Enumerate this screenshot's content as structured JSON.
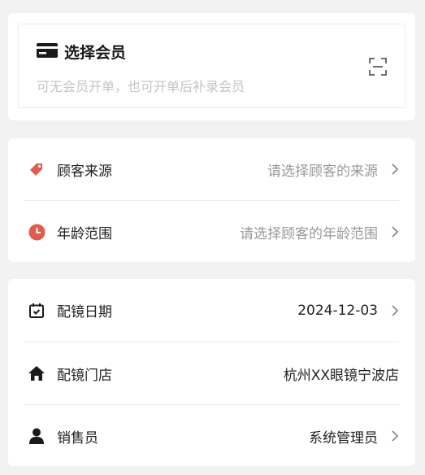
{
  "member": {
    "title": "选择会员",
    "hint": "可无会员开单，也可开单后补录会员",
    "icon": "card-icon",
    "scan_icon": "scan-icon"
  },
  "source_section": {
    "rows": [
      {
        "label": "顾客来源",
        "value": "请选择顾客的来源",
        "icon": "tag-icon",
        "icon_color": "#e25b4f"
      },
      {
        "label": "年龄范围",
        "value": "请选择顾客的年龄范围",
        "icon": "clock-icon",
        "icon_color": "#e25b4f"
      }
    ]
  },
  "info_section": {
    "rows": [
      {
        "label": "配镜日期",
        "value": "2024-12-03",
        "icon": "calendar-check-icon"
      },
      {
        "label": "配镜门店",
        "value": "杭州XX眼镜宁波店",
        "icon": "home-icon"
      },
      {
        "label": "销售员",
        "value": "系统管理员",
        "icon": "user-icon"
      }
    ]
  },
  "colors": {
    "background": "#f2f2f2",
    "card": "#ffffff",
    "placeholder": "#999999",
    "accent_red": "#e25b4f"
  }
}
